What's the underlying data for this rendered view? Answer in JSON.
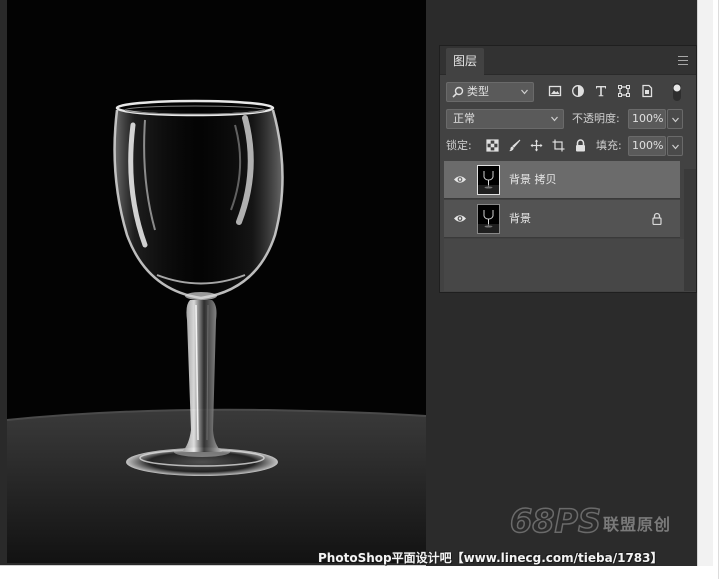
{
  "layers_panel": {
    "tab_label": "图层",
    "filter": {
      "selected": "类型"
    },
    "blend_mode": "正常",
    "opacity_label": "不透明度:",
    "opacity_value": "100%",
    "lock_label": "锁定:",
    "fill_label": "填充:",
    "fill_value": "100%",
    "layers": [
      {
        "name": "背景 拷贝",
        "selected": true,
        "visible": true,
        "locked": false
      },
      {
        "name": "背景",
        "selected": false,
        "visible": true,
        "locked": true
      }
    ]
  },
  "watermark": {
    "logo_text": "68PS",
    "logo_suffix": "联盟原创",
    "caption": "PhotoShop平面设计吧【www.linecg.com/tieba/1783】"
  },
  "colors": {
    "panel_bg": "#424242",
    "workspace_bg": "#2b2b2b",
    "selected_row": "#6b6b6b"
  }
}
